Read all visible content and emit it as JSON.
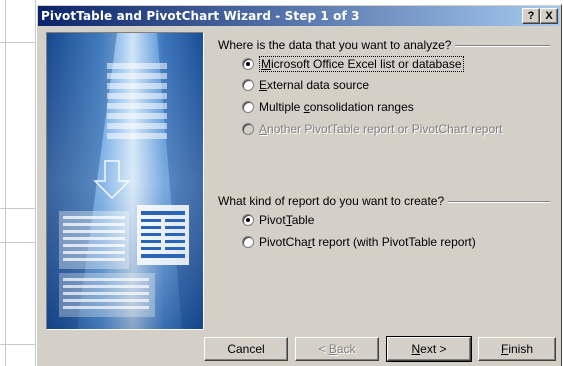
{
  "window": {
    "title": "PivotTable and PivotChart Wizard - Step 1 of 3",
    "help_button": "?",
    "close_button": "X"
  },
  "data_source": {
    "question": "Where is the data that you want to analyze?",
    "options": [
      {
        "pre": "",
        "key": "M",
        "post": "icrosoft Office Excel list or database",
        "checked": true,
        "disabled": false
      },
      {
        "pre": "",
        "key": "E",
        "post": "xternal data source",
        "checked": false,
        "disabled": false
      },
      {
        "pre": "Multiple ",
        "key": "c",
        "post": "onsolidation ranges",
        "checked": false,
        "disabled": false
      },
      {
        "pre": "",
        "key": "A",
        "post": "nother PivotTable report or PivotChart report",
        "checked": false,
        "disabled": true
      }
    ]
  },
  "report_kind": {
    "question": "What kind of report do you want to create?",
    "options": [
      {
        "pre": "Pivot",
        "key": "T",
        "post": "able",
        "checked": true,
        "disabled": false
      },
      {
        "pre": "PivotCha",
        "key": "r",
        "post": "t report (with PivotTable report)",
        "checked": false,
        "disabled": false
      }
    ]
  },
  "buttons": {
    "cancel": {
      "pre": "Cancel",
      "key": "",
      "post": ""
    },
    "back": {
      "pre": "< ",
      "key": "B",
      "post": "ack"
    },
    "next": {
      "pre": "",
      "key": "N",
      "post": "ext >"
    },
    "finish": {
      "pre": "",
      "key": "F",
      "post": "inish"
    }
  },
  "colors": {
    "dialog_face": "#d4d0c8",
    "titlebar_start": "#0a246a",
    "titlebar_end": "#a6caf0",
    "art_blue": "#3f7ec7"
  }
}
